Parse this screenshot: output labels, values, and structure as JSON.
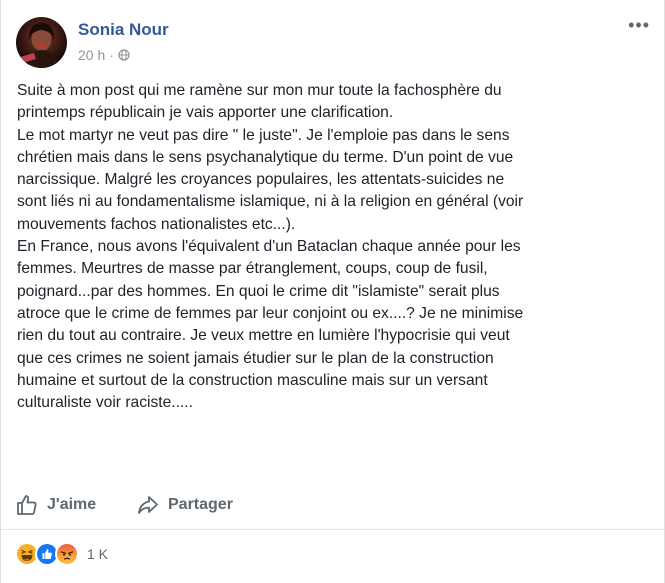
{
  "post": {
    "author": "Sonia Nour",
    "time": "20 h",
    "separator": "·",
    "body": "Suite à mon post qui me ramène sur mon mur toute la fachosphère du\nprintemps républicain je vais apporter une clarification.\nLe mot martyr ne veut pas dire \" le juste\". Je l'emploie pas dans le sens\nchrétien mais dans le sens psychanalytique du terme. D'un point de vue\nnarcissique. Malgré les croyances populaires, les attentats-suicides ne\nsont liés ni au fondamentalisme islamique, ni à la religion en général (voir\nmouvements fachos nationalistes etc...).\nEn France, nous avons l'équivalent d'un Bataclan chaque année pour les\nfemmes. Meurtres de masse par étranglement, coups, coup de fusil,\npoignard...par des hommes. En quoi le crime dit \"islamiste\" serait plus\natroce que le crime de femmes par leur conjoint ou ex....? Je ne minimise\nrien du tout au contraire. Je veux mettre en lumière l'hypocrisie qui veut\nque ces crimes ne soient jamais étudier sur le plan de la construction\nhumaine et surtout de la construction masculine mais sur un versant\nculturaliste voir raciste....."
  },
  "header": {
    "more_label": "•••"
  },
  "actions": {
    "like_label": "J'aime",
    "share_label": "Partager"
  },
  "reactions": {
    "icons": [
      "haha-icon",
      "like-icon",
      "angry-icon"
    ],
    "count": "1 K"
  },
  "colors": {
    "link_blue": "#365899",
    "text": "#1d2129",
    "meta_gray": "#90949c",
    "action_gray": "#606770",
    "like_blue": "#1877f2"
  }
}
